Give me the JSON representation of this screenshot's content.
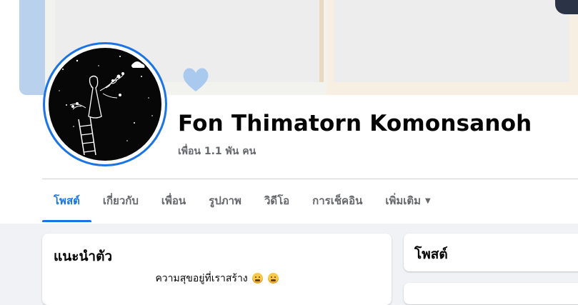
{
  "profile": {
    "name": "Fon Thimatorn Komonsanoh",
    "friends": "เพื่อน 1.1 พัน คน"
  },
  "tabs": [
    {
      "label": "โพสต์",
      "active": true
    },
    {
      "label": "เกี่ยวกับ"
    },
    {
      "label": "เพื่อน"
    },
    {
      "label": "รูปภาพ"
    },
    {
      "label": "วิดีโอ"
    },
    {
      "label": "การเช็คอิน"
    },
    {
      "label": "เพิ่มเติม"
    }
  ],
  "intro": {
    "title": "แนะนำตัว",
    "bio": "ความสุขอยู่ที่เราสร้าง"
  },
  "posts": {
    "title": "โพสต์"
  },
  "colors": {
    "accent": "#1b74e4",
    "background": "#f0f2f5"
  }
}
